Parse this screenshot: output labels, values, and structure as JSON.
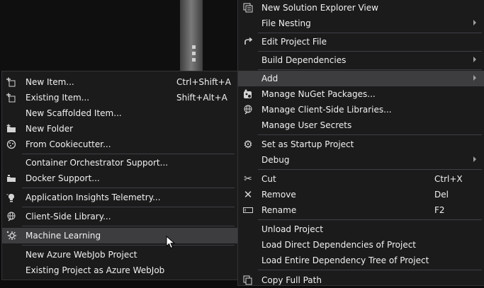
{
  "right_menu": {
    "new_solution_explorer_view": "New Solution Explorer View",
    "file_nesting": "File Nesting",
    "edit_project_file": "Edit Project File",
    "build_dependencies": "Build Dependencies",
    "add": "Add",
    "manage_nuget": "Manage NuGet Packages...",
    "manage_client_side": "Manage Client-Side Libraries...",
    "manage_user_secrets": "Manage User Secrets",
    "set_startup": "Set as Startup Project",
    "debug": "Debug",
    "cut": "Cut",
    "cut_shortcut": "Ctrl+X",
    "remove": "Remove",
    "remove_shortcut": "Del",
    "rename": "Rename",
    "rename_shortcut": "F2",
    "unload_project": "Unload Project",
    "load_direct": "Load Direct Dependencies of Project",
    "load_entire": "Load Entire Dependency Tree of Project",
    "copy_full_path": "Copy Full Path"
  },
  "add_submenu": {
    "new_item": "New Item...",
    "new_item_shortcut": "Ctrl+Shift+A",
    "existing_item": "Existing Item...",
    "existing_item_shortcut": "Shift+Alt+A",
    "new_scaffolded_item": "New Scaffolded Item...",
    "new_folder": "New Folder",
    "from_cookiecutter": "From Cookiecutter...",
    "container_orchestrator": "Container Orchestrator Support...",
    "docker_support": "Docker Support...",
    "app_insights": "Application Insights Telemetry...",
    "client_side_library": "Client-Side Library...",
    "machine_learning": "Machine Learning",
    "new_azure_webjob": "New Azure WebJob Project",
    "existing_as_webjob": "Existing Project as Azure WebJob"
  },
  "icons": {
    "new_solution_explorer_view": "solution-explorer-icon",
    "edit_project_file": "edit-redo-icon",
    "manage_nuget": "nuget-icon",
    "manage_client_side": "client-library-icon",
    "set_startup": "gear-icon",
    "cut": "scissors-icon",
    "remove": "close-icon",
    "rename": "rename-icon",
    "copy_full_path": "copy-icon",
    "new_item": "new-item-icon",
    "existing_item": "existing-item-icon",
    "new_folder": "folder-icon",
    "from_cookiecutter": "cookiecutter-icon",
    "docker_support": "docker-icon",
    "app_insights": "app-insights-icon",
    "client_side_library": "client-library-icon",
    "machine_learning": "machine-learning-icon"
  },
  "colors": {
    "menu_bg": "#1b1b1c",
    "hover_bg": "#3d3d40",
    "separator": "#3f3f46",
    "text": "#f1f1f1"
  }
}
